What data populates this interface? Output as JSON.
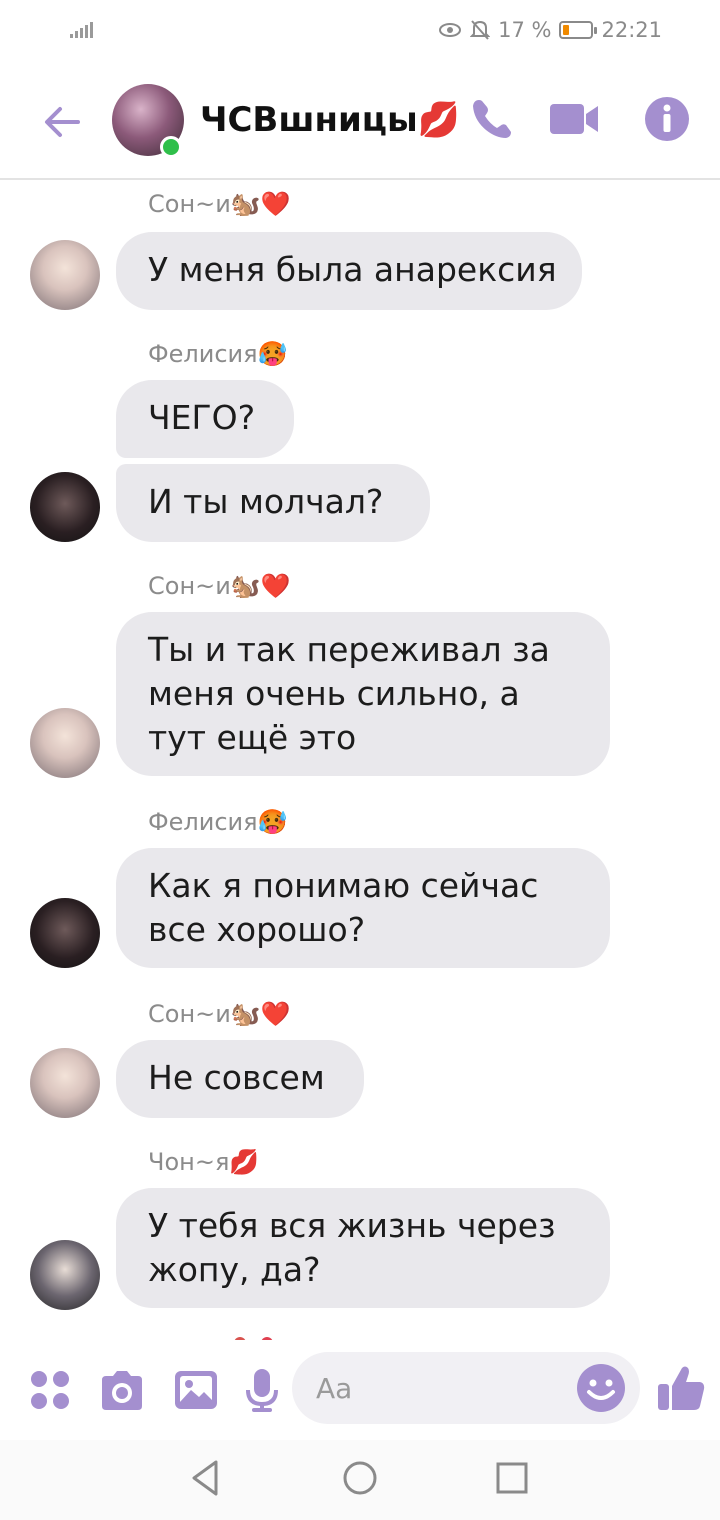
{
  "status_bar": {
    "notification_percent": "17 %",
    "time": "22:21"
  },
  "header": {
    "chat_title": "ЧСВшницы💋",
    "back_icon": "arrow-left-icon",
    "call_icon": "phone-icon",
    "video_icon": "video-icon",
    "info_icon": "info-icon"
  },
  "messages": [
    {
      "sender": "Сон~и🐿️❤️",
      "text": "У меня была анарексия"
    },
    {
      "sender": "Фелисия🥵",
      "text": "ЧЕГО?"
    },
    {
      "sender": "",
      "text": "И ты молчал?"
    },
    {
      "sender": "Сон~и🐿️❤️",
      "text": "Ты и так переживал за меня очень сильно, а тут ещё это"
    },
    {
      "sender": "Фелисия🥵",
      "text": "Как я понимаю сейчас все хорошо?"
    },
    {
      "sender": "Сон~и🐿️❤️",
      "text": "Не совсем"
    },
    {
      "sender": "Чон~я💋",
      "text": "У тебя вся жизнь через жопу, да?"
    }
  ],
  "composer": {
    "placeholder": "Aa"
  },
  "colors": {
    "accent": "#a48fcf",
    "bubble": "#e9e8ec",
    "online": "#2fbf4a",
    "battery": "#f08a00"
  }
}
